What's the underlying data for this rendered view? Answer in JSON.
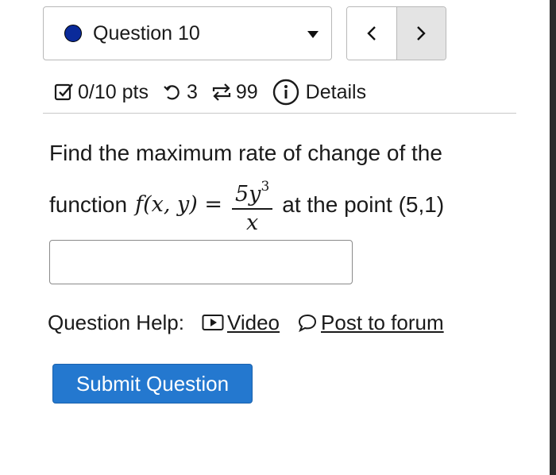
{
  "question_select": {
    "label": "Question 10",
    "status_color": "#0a2a9a"
  },
  "nav": {
    "prev_icon": "chevron-left-icon",
    "next_icon": "chevron-right-icon"
  },
  "status": {
    "points": "0/10 pts",
    "attempts": "3",
    "versions": "99",
    "details": "Details"
  },
  "question": {
    "line1": "Find the maximum rate of change of the",
    "prefix": "function",
    "func": "f(x, y) =",
    "numerator": "5y",
    "exponent": "3",
    "denominator": "x",
    "suffix": "at the point (5,1)"
  },
  "answer": {
    "value": "",
    "placeholder": ""
  },
  "help": {
    "label": "Question Help:",
    "video": "Video",
    "forum": "Post to forum"
  },
  "submit": {
    "label": "Submit Question",
    "color": "#2478cf"
  }
}
